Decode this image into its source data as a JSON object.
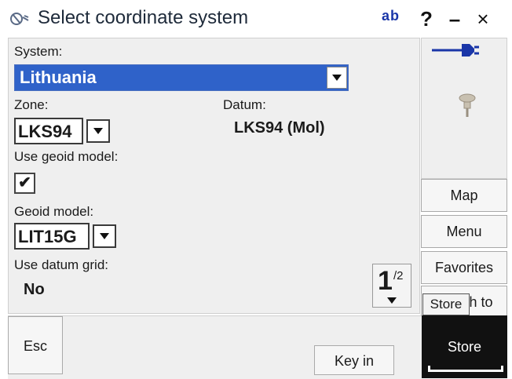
{
  "title": "Select coordinate system",
  "titlebar": {
    "ab": "ab",
    "help": "?",
    "minimize": "–",
    "close": "×"
  },
  "system": {
    "label": "System:",
    "value": "Lithuania"
  },
  "zone": {
    "label": "Zone:",
    "value": "LKS94"
  },
  "datum": {
    "label": "Datum:",
    "value": "LKS94 (Mol)"
  },
  "geoid": {
    "use_label": "Use geoid model:",
    "checked": "✔",
    "model_label": "Geoid model:",
    "model_value": "LIT15G"
  },
  "datum_grid": {
    "label": "Use datum grid:",
    "value": "No"
  },
  "page": {
    "current": "1",
    "total": "/2"
  },
  "side": {
    "map": "Map",
    "menu": "Menu",
    "favorites": "Favorites",
    "switch_to": "Switch to",
    "tooltip": "Store"
  },
  "bottom": {
    "esc": "Esc",
    "key_in": "Key in",
    "store": "Store"
  },
  "colors": {
    "selection": "#2f62c9",
    "store_bg": "#111111",
    "icon_blue": "#1a36a8"
  }
}
